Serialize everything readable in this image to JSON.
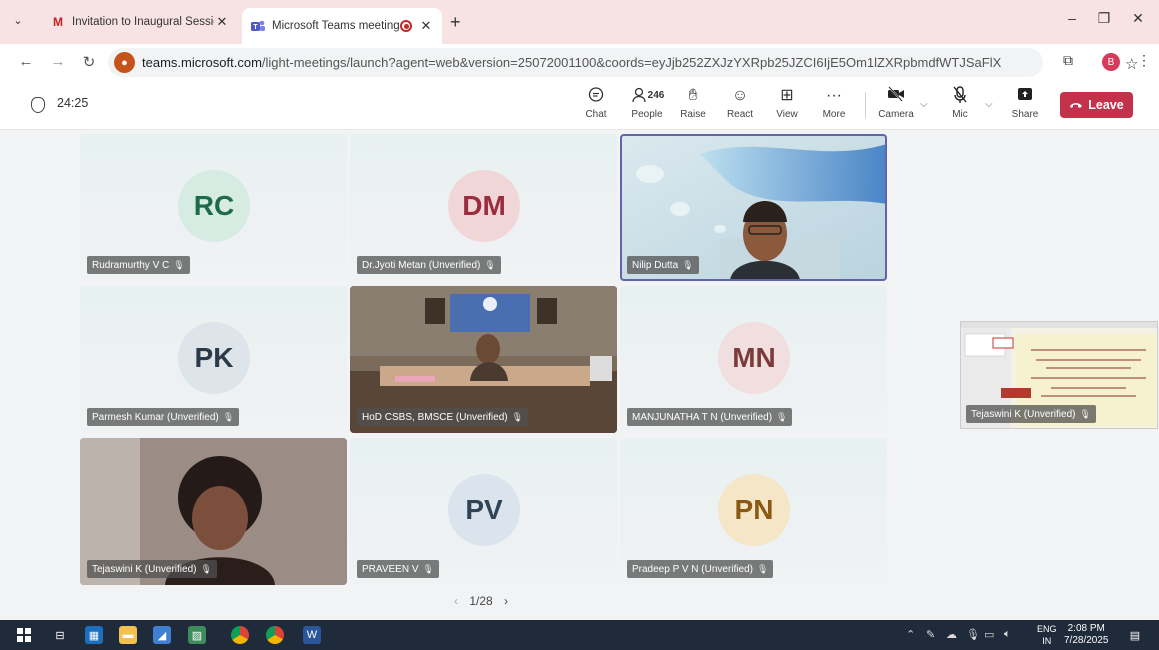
{
  "browser": {
    "tabs": [
      {
        "title": "Invitation to Inaugural Session",
        "favicon": "M"
      },
      {
        "title": "Microsoft Teams meeting |",
        "favicon": "teams-icon"
      }
    ],
    "url_host": "teams.microsoft.com",
    "url_path": "/light-meetings/launch?agent=web&version=25072001100&coords=eyJjb252ZXJzYXRpb25JZCI6IjE5Om1lZXRpbmdfWTJSaFlXRXlZV0l0WkdJNF...",
    "profile_initial": "B"
  },
  "toolbar": {
    "timer": "24:25",
    "chat": "Chat",
    "people": "People",
    "people_count": "246",
    "raise": "Raise",
    "react": "React",
    "view": "View",
    "more": "More",
    "camera": "Camera",
    "mic": "Mic",
    "share": "Share",
    "leave": "Leave"
  },
  "participants": [
    {
      "initials": "RC",
      "name": "Rudramurthy V C",
      "bg": "#d6ece3",
      "fg": "#1e6b4c"
    },
    {
      "initials": "DM",
      "name": "Dr.Jyoti Metan (Unverified)",
      "bg": "#f1d6d8",
      "fg": "#9b2c3e"
    },
    {
      "initials": "",
      "name": "Nilip Dutta",
      "video": true
    },
    {
      "initials": "PK",
      "name": "Parmesh Kumar (Unverified)",
      "bg": "#dde4ea",
      "fg": "#2b3a48"
    },
    {
      "initials": "",
      "name": "HoD CSBS, BMSCE (Unverified)",
      "video": true
    },
    {
      "initials": "MN",
      "name": "MANJUNATHA T N (Unverified)",
      "bg": "#f1dede",
      "fg": "#7b3b3b"
    },
    {
      "initials": "",
      "name": "Tejaswini K (Unverified)",
      "video": true
    },
    {
      "initials": "PV",
      "name": "PRAVEEN V",
      "bg": "#dbe4ec",
      "fg": "#2f4456"
    },
    {
      "initials": "PN",
      "name": "Pradeep P V N (Unverified)",
      "bg": "#f6e6c8",
      "fg": "#8a5a14"
    }
  ],
  "pager": "1/28",
  "shared_screen": {
    "presenter": "Tejaswini K (Unverified)"
  },
  "taskbar": {
    "lang_top": "ENG",
    "lang_bottom": "IN",
    "time": "2:08 PM",
    "date": "7/28/2025"
  },
  "colors": {
    "leave": "#c4314b",
    "active_border": "#6264a7",
    "tab_bar": "#f7e3e3"
  }
}
